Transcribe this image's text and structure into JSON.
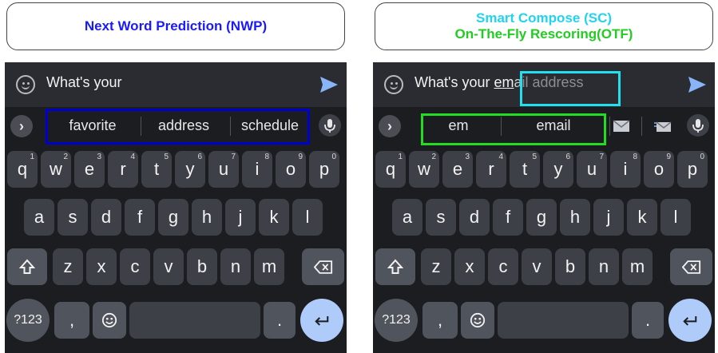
{
  "left_panel": {
    "title": "Next Word Prediction (NWP)",
    "title_color": "#1a1aff",
    "highlight_color": "#0000cc",
    "compose_text": "What's your",
    "suggestions": [
      "favorite",
      "address",
      "schedule"
    ]
  },
  "right_panel": {
    "title_line1": "Smart Compose (SC)",
    "title_line1_color": "#22d3ee",
    "title_line2": "On-The-Fly Rescoring(OTF)",
    "title_line2_color": "#22cc22",
    "compose_typed": "What's your ",
    "compose_partial_underlined": "em",
    "compose_partial_overlap": "a",
    "compose_ghost": "il address",
    "highlight_ghost_color": "#22e0ee",
    "highlight_sugg_color": "#22dd22",
    "suggestions": [
      "em",
      "email"
    ],
    "extra_icons": [
      "mail-icon",
      "send-mail-icon"
    ]
  },
  "keyboard": {
    "row1": [
      {
        "k": "q",
        "h": "1"
      },
      {
        "k": "w",
        "h": "2"
      },
      {
        "k": "e",
        "h": "3"
      },
      {
        "k": "r",
        "h": "4"
      },
      {
        "k": "t",
        "h": "5"
      },
      {
        "k": "y",
        "h": "6"
      },
      {
        "k": "u",
        "h": "7"
      },
      {
        "k": "i",
        "h": "8"
      },
      {
        "k": "o",
        "h": "9"
      },
      {
        "k": "p",
        "h": "0"
      }
    ],
    "row2": [
      "a",
      "s",
      "d",
      "f",
      "g",
      "h",
      "j",
      "k",
      "l"
    ],
    "row3": [
      "z",
      "x",
      "c",
      "v",
      "b",
      "n",
      "m"
    ],
    "sym_label": "?123",
    "comma": ",",
    "period": ".",
    "icons": [
      "shift-icon",
      "backspace-icon",
      "emoji-key-icon",
      "enter-icon"
    ]
  },
  "icons": [
    "smiley-icon",
    "send-icon",
    "chevron-right-icon",
    "mic-icon"
  ]
}
